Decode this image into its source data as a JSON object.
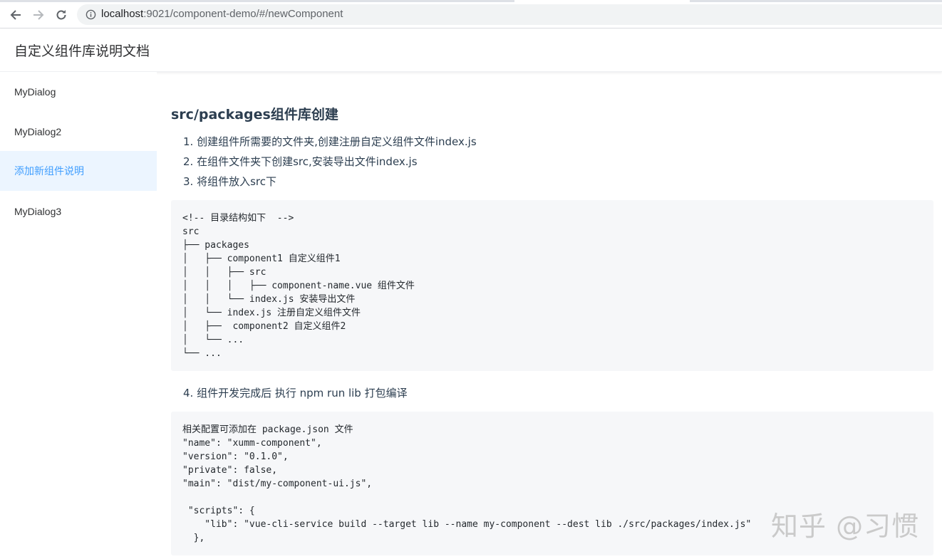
{
  "browser": {
    "url_host": "localhost",
    "url_rest": ":9021/component-demo/#/newComponent",
    "icons": {
      "back": "arrow-left-icon",
      "forward": "arrow-right-icon",
      "reload": "reload-icon",
      "info": "info-circle-icon"
    }
  },
  "header": {
    "title": "自定义组件库说明文档"
  },
  "sidebar": {
    "items": [
      {
        "label": "MyDialog",
        "active": false
      },
      {
        "label": "MyDialog2",
        "active": false
      },
      {
        "label": "添加新组件说明",
        "active": true
      },
      {
        "label": "MyDialog3",
        "active": false
      }
    ],
    "active_color": "#409eff",
    "active_bg": "#ecf5ff"
  },
  "main": {
    "section_title": "src/packages组件库创建",
    "steps": [
      "1. 创建组件所需要的文件夹,创建注册自定义组件文件index.js",
      "2. 在组件文件夹下创建src,安装导出文件index.js",
      "3. 将组件放入src下",
      "4. 组件开发完成后 执行 npm run lib 打包编译"
    ],
    "tree_code": [
      "<!-- 目录结构如下  -->",
      "src",
      "├── packages",
      "│   ├── component1 自定义组件1",
      "│   │   ├── src",
      "│   │   │   ├── component-name.vue 组件文件",
      "│   │   └── index.js 安装导出文件",
      "│   └── index.js 注册自定义组件文件",
      "│   ├──  component2 自定义组件2",
      "│   └── ...",
      "└── ..."
    ],
    "config_code": [
      "相关配置可添加在 package.json 文件",
      "\"name\": \"xumm-component\",",
      "\"version\": \"0.1.0\",",
      "\"private\": false,",
      "\"main\": \"dist/my-component-ui.js\",",
      "",
      " \"scripts\": {",
      "    \"lib\": \"vue-cli-service build --target lib --name my-component --dest lib ./src/packages/index.js\"",
      "  },"
    ]
  },
  "watermark": "知乎 @习惯"
}
